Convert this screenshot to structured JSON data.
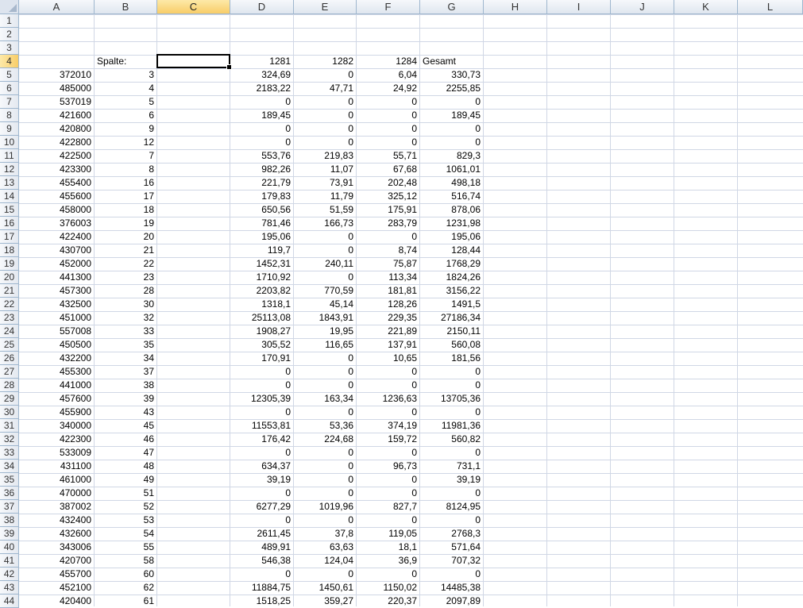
{
  "columns": [
    "A",
    "B",
    "C",
    "D",
    "E",
    "F",
    "G",
    "H",
    "I",
    "J",
    "K",
    "L"
  ],
  "active_column": "C",
  "active_row": 4,
  "header_row": {
    "B": "Spalte:",
    "D": "1281",
    "E": "1282",
    "F": "1284",
    "G": "Gesamt"
  },
  "rows": [
    {
      "n": 1
    },
    {
      "n": 2
    },
    {
      "n": 3
    },
    {
      "n": 4
    },
    {
      "n": 5,
      "A": "372010",
      "B": "3",
      "D": "324,69",
      "E": "0",
      "F": "6,04",
      "G": "330,73"
    },
    {
      "n": 6,
      "A": "485000",
      "B": "4",
      "D": "2183,22",
      "E": "47,71",
      "F": "24,92",
      "G": "2255,85"
    },
    {
      "n": 7,
      "A": "537019",
      "B": "5",
      "D": "0",
      "E": "0",
      "F": "0",
      "G": "0"
    },
    {
      "n": 8,
      "A": "421600",
      "B": "6",
      "D": "189,45",
      "E": "0",
      "F": "0",
      "G": "189,45"
    },
    {
      "n": 9,
      "A": "420800",
      "B": "9",
      "D": "0",
      "E": "0",
      "F": "0",
      "G": "0"
    },
    {
      "n": 10,
      "A": "422800",
      "B": "12",
      "D": "0",
      "E": "0",
      "F": "0",
      "G": "0"
    },
    {
      "n": 11,
      "A": "422500",
      "B": "7",
      "D": "553,76",
      "E": "219,83",
      "F": "55,71",
      "G": "829,3"
    },
    {
      "n": 12,
      "A": "423300",
      "B": "8",
      "D": "982,26",
      "E": "11,07",
      "F": "67,68",
      "G": "1061,01"
    },
    {
      "n": 13,
      "A": "455400",
      "B": "16",
      "D": "221,79",
      "E": "73,91",
      "F": "202,48",
      "G": "498,18"
    },
    {
      "n": 14,
      "A": "455600",
      "B": "17",
      "D": "179,83",
      "E": "11,79",
      "F": "325,12",
      "G": "516,74"
    },
    {
      "n": 15,
      "A": "458000",
      "B": "18",
      "D": "650,56",
      "E": "51,59",
      "F": "175,91",
      "G": "878,06"
    },
    {
      "n": 16,
      "A": "376003",
      "B": "19",
      "D": "781,46",
      "E": "166,73",
      "F": "283,79",
      "G": "1231,98"
    },
    {
      "n": 17,
      "A": "422400",
      "B": "20",
      "D": "195,06",
      "E": "0",
      "F": "0",
      "G": "195,06"
    },
    {
      "n": 18,
      "A": "430700",
      "B": "21",
      "D": "119,7",
      "E": "0",
      "F": "8,74",
      "G": "128,44"
    },
    {
      "n": 19,
      "A": "452000",
      "B": "22",
      "D": "1452,31",
      "E": "240,11",
      "F": "75,87",
      "G": "1768,29"
    },
    {
      "n": 20,
      "A": "441300",
      "B": "23",
      "D": "1710,92",
      "E": "0",
      "F": "113,34",
      "G": "1824,26"
    },
    {
      "n": 21,
      "A": "457300",
      "B": "28",
      "D": "2203,82",
      "E": "770,59",
      "F": "181,81",
      "G": "3156,22"
    },
    {
      "n": 22,
      "A": "432500",
      "B": "30",
      "D": "1318,1",
      "E": "45,14",
      "F": "128,26",
      "G": "1491,5"
    },
    {
      "n": 23,
      "A": "451000",
      "B": "32",
      "D": "25113,08",
      "E": "1843,91",
      "F": "229,35",
      "G": "27186,34"
    },
    {
      "n": 24,
      "A": "557008",
      "B": "33",
      "D": "1908,27",
      "E": "19,95",
      "F": "221,89",
      "G": "2150,11"
    },
    {
      "n": 25,
      "A": "450500",
      "B": "35",
      "D": "305,52",
      "E": "116,65",
      "F": "137,91",
      "G": "560,08"
    },
    {
      "n": 26,
      "A": "432200",
      "B": "34",
      "D": "170,91",
      "E": "0",
      "F": "10,65",
      "G": "181,56"
    },
    {
      "n": 27,
      "A": "455300",
      "B": "37",
      "D": "0",
      "E": "0",
      "F": "0",
      "G": "0"
    },
    {
      "n": 28,
      "A": "441000",
      "B": "38",
      "D": "0",
      "E": "0",
      "F": "0",
      "G": "0"
    },
    {
      "n": 29,
      "A": "457600",
      "B": "39",
      "D": "12305,39",
      "E": "163,34",
      "F": "1236,63",
      "G": "13705,36"
    },
    {
      "n": 30,
      "A": "455900",
      "B": "43",
      "D": "0",
      "E": "0",
      "F": "0",
      "G": "0"
    },
    {
      "n": 31,
      "A": "340000",
      "B": "45",
      "D": "11553,81",
      "E": "53,36",
      "F": "374,19",
      "G": "11981,36"
    },
    {
      "n": 32,
      "A": "422300",
      "B": "46",
      "D": "176,42",
      "E": "224,68",
      "F": "159,72",
      "G": "560,82"
    },
    {
      "n": 33,
      "A": "533009",
      "B": "47",
      "D": "0",
      "E": "0",
      "F": "0",
      "G": "0"
    },
    {
      "n": 34,
      "A": "431100",
      "B": "48",
      "D": "634,37",
      "E": "0",
      "F": "96,73",
      "G": "731,1"
    },
    {
      "n": 35,
      "A": "461000",
      "B": "49",
      "D": "39,19",
      "E": "0",
      "F": "0",
      "G": "39,19"
    },
    {
      "n": 36,
      "A": "470000",
      "B": "51",
      "D": "0",
      "E": "0",
      "F": "0",
      "G": "0"
    },
    {
      "n": 37,
      "A": "387002",
      "B": "52",
      "D": "6277,29",
      "E": "1019,96",
      "F": "827,7",
      "G": "8124,95"
    },
    {
      "n": 38,
      "A": "432400",
      "B": "53",
      "D": "0",
      "E": "0",
      "F": "0",
      "G": "0"
    },
    {
      "n": 39,
      "A": "432600",
      "B": "54",
      "D": "2611,45",
      "E": "37,8",
      "F": "119,05",
      "G": "2768,3"
    },
    {
      "n": 40,
      "A": "343006",
      "B": "55",
      "D": "489,91",
      "E": "63,63",
      "F": "18,1",
      "G": "571,64"
    },
    {
      "n": 41,
      "A": "420700",
      "B": "58",
      "D": "546,38",
      "E": "124,04",
      "F": "36,9",
      "G": "707,32"
    },
    {
      "n": 42,
      "A": "455700",
      "B": "60",
      "D": "0",
      "E": "0",
      "F": "0",
      "G": "0"
    },
    {
      "n": 43,
      "A": "452100",
      "B": "62",
      "D": "11884,75",
      "E": "1450,61",
      "F": "1150,02",
      "G": "14485,38"
    },
    {
      "n": 44,
      "A": "420400",
      "B": "61",
      "D": "1518,25",
      "E": "359,27",
      "F": "220,37",
      "G": "2097,89"
    }
  ]
}
